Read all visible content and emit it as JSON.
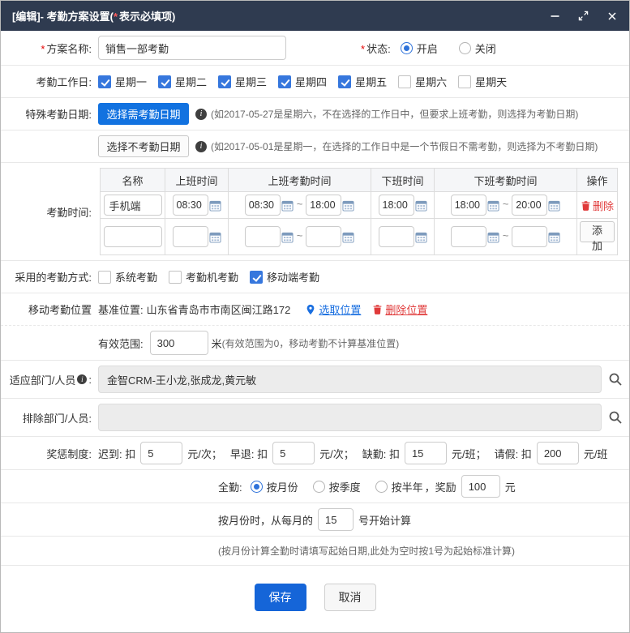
{
  "titlebar": {
    "title_pre": "[编辑]- 考勤方案设置(",
    "star": "*",
    "title_post": "表示必填项)"
  },
  "plan": {
    "star": "*",
    "label": "方案名称:",
    "value": "销售一部考勤"
  },
  "status": {
    "star": "*",
    "label": "状态:",
    "on_label": "开启",
    "on_checked": true,
    "off_label": "关闭",
    "off_checked": false
  },
  "workdays": {
    "label": "考勤工作日:",
    "items": [
      {
        "label": "星期一",
        "checked": true
      },
      {
        "label": "星期二",
        "checked": true
      },
      {
        "label": "星期三",
        "checked": true
      },
      {
        "label": "星期四",
        "checked": true
      },
      {
        "label": "星期五",
        "checked": true
      },
      {
        "label": "星期六",
        "checked": false
      },
      {
        "label": "星期天",
        "checked": false
      }
    ]
  },
  "special": {
    "label": "特殊考勤日期:",
    "need_button": "选择需考勤日期",
    "need_hint": "(如2017-05-27是星期六，不在选择的工作日中，但要求上班考勤，则选择为考勤日期)",
    "no_button": "选择不考勤日期",
    "no_hint": "(如2017-05-01是星期一，在选择的工作日中是一个节假日不需考勤，则选择为不考勤日期)"
  },
  "timetable": {
    "label": "考勤时间:",
    "headers": {
      "name": "名称",
      "start": "上班时间",
      "start_range": "上班考勤时间",
      "end": "下班时间",
      "end_range": "下班考勤时间",
      "ops": "操作"
    },
    "tilde": "~",
    "row1": {
      "name": "手机端",
      "start": "08:30",
      "start_from": "08:30",
      "start_to": "18:00",
      "end": "18:00",
      "end_from": "18:00",
      "end_to": "20:00",
      "delete_label": "删除"
    },
    "row2": {
      "add_label": "添加"
    }
  },
  "methods": {
    "label": "采用的考勤方式:",
    "items": [
      {
        "label": "系统考勤",
        "checked": false
      },
      {
        "label": "考勤机考勤",
        "checked": false
      },
      {
        "label": "移动端考勤",
        "checked": true
      }
    ]
  },
  "location": {
    "label": "移动考勤位置",
    "base_label": "基准位置:",
    "base_value": "山东省青岛市市南区闽江路172",
    "pick_label": "选取位置",
    "delete_label": "删除位置",
    "range_label": "有效范围:",
    "range_value": "300",
    "range_unit": "米",
    "range_hint": "(有效范围为0，移动考勤不计算基准位置)"
  },
  "departments": {
    "include_label": "适应部门/人员",
    "include_colon": ":",
    "include_value": "金智CRM-王小龙,张成龙,黄元敏",
    "exclude_label": "排除部门/人员:",
    "exclude_value": ""
  },
  "rewards": {
    "label": "奖惩制度:",
    "late_pre": "迟到: 扣",
    "late_value": "5",
    "late_post": "元/次；",
    "early_pre": "早退: 扣",
    "early_value": "5",
    "early_post": "元/次；",
    "absent_pre": "缺勤: 扣",
    "absent_value": "15",
    "absent_post": "元/班；",
    "leave_pre": "请假: 扣",
    "leave_value": "200",
    "leave_post": "元/班"
  },
  "full": {
    "label": "全勤:",
    "options": [
      {
        "label": "按月份",
        "checked": true
      },
      {
        "label": "按季度",
        "checked": false
      },
      {
        "label": "按半年",
        "checked": false
      }
    ],
    "bonus_pre": "，奖励",
    "bonus_value": "100",
    "bonus_post": "元",
    "monthly_pre": "按月份时，从每月的",
    "monthly_value": "15",
    "monthly_post": "号开始计算",
    "hint": "(按月份计算全勤时请填写起始日期,此处为空时按1号为起始标准计算)"
  },
  "footer": {
    "save": "保存",
    "cancel": "取消"
  }
}
